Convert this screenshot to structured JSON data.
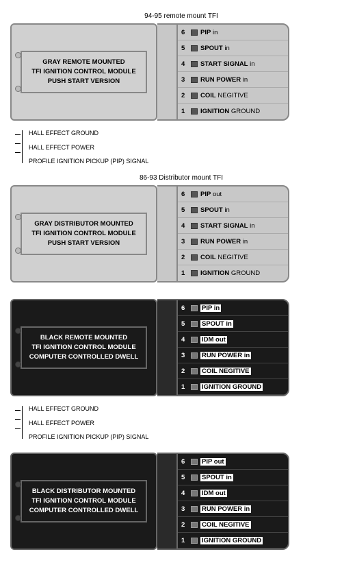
{
  "sections": [
    {
      "id": "gray-remote",
      "topLabel": "94-95 remote mount TFI",
      "moduleText": "GRAY REMOTE MOUNTED\nTFI IGNITION CONTROL MODULE\nPUSH START VERSION",
      "isBlack": false,
      "pins": [
        {
          "num": 6,
          "label": "PIP in",
          "bold": [
            "PIP"
          ]
        },
        {
          "num": 5,
          "label": "SPOUT in",
          "bold": [
            "SPOUT"
          ]
        },
        {
          "num": 4,
          "label": "START SIGNAL in",
          "bold": [
            "START SIGNAL"
          ]
        },
        {
          "num": 3,
          "label": "RUN POWER in",
          "bold": [
            "RUN POWER"
          ]
        },
        {
          "num": 2,
          "label": "COIL NEGITIVE",
          "bold": [
            "COIL"
          ]
        },
        {
          "num": 1,
          "label": "IGNITION GROUND",
          "bold": [
            "IGNITION"
          ]
        }
      ],
      "wires": null
    },
    {
      "id": "gray-dist",
      "topLabel": "86-93 Distributor mount TFI",
      "moduleText": "GRAY DISTRIBUTOR MOUNTED\nTFI IGNITION CONTROL MODULE\nPUSH START VERSION",
      "isBlack": false,
      "pins": [
        {
          "num": 6,
          "label": "PIP out",
          "bold": [
            "PIP"
          ]
        },
        {
          "num": 5,
          "label": "SPOUT in",
          "bold": [
            "SPOUT"
          ]
        },
        {
          "num": 4,
          "label": "START SIGNAL in",
          "bold": [
            "START SIGNAL"
          ]
        },
        {
          "num": 3,
          "label": "RUN POWER in",
          "bold": [
            "RUN POWER"
          ]
        },
        {
          "num": 2,
          "label": "COIL NEGITIVE",
          "bold": [
            "COIL"
          ]
        },
        {
          "num": 1,
          "label": "IGNITION GROUND",
          "bold": [
            "IGNITION"
          ]
        }
      ],
      "wires": {
        "items": [
          "HALL EFFECT GROUND",
          "HALL EFFECT POWER",
          "PROFILE IGNITION PICKUP (PIP) SIGNAL"
        ]
      }
    },
    {
      "id": "black-remote",
      "topLabel": null,
      "moduleText": "BLACK REMOTE MOUNTED\nTFI IGNITION CONTROL MODULE\nCOMPUTER CONTROLLED DWELL",
      "isBlack": true,
      "pins": [
        {
          "num": 6,
          "label": "PIP in",
          "bold": [
            "PIP"
          ]
        },
        {
          "num": 5,
          "label": "SPOUT in",
          "bold": [
            "SPOUT"
          ]
        },
        {
          "num": 4,
          "label": "IDM out",
          "bold": [
            "IDM"
          ]
        },
        {
          "num": 3,
          "label": "RUN POWER in",
          "bold": [
            "RUN POWER"
          ]
        },
        {
          "num": 2,
          "label": "COIL NEGITIVE",
          "bold": [
            "COIL"
          ]
        },
        {
          "num": 1,
          "label": "IGNITION GROUND",
          "bold": [
            "IGNITION"
          ]
        }
      ],
      "wires": null
    },
    {
      "id": "black-dist",
      "topLabel": null,
      "moduleText": "BLACK DISTRIBUTOR MOUNTED\nTFI IGNITION CONTROL MODULE\nCOMPUTER CONTROLLED DWELL",
      "isBlack": true,
      "pins": [
        {
          "num": 6,
          "label": "PIP out",
          "bold": [
            "PIP"
          ]
        },
        {
          "num": 5,
          "label": "SPOUT in",
          "bold": [
            "SPOUT"
          ]
        },
        {
          "num": 4,
          "label": "IDM out",
          "bold": [
            "IDM"
          ]
        },
        {
          "num": 3,
          "label": "RUN POWER in",
          "bold": [
            "RUN POWER"
          ]
        },
        {
          "num": 2,
          "label": "COIL NEGITIVE",
          "bold": [
            "COIL"
          ]
        },
        {
          "num": 1,
          "label": "IGNITION GROUND",
          "bold": [
            "IGNITION"
          ]
        }
      ],
      "wires": {
        "items": [
          "HALL EFFECT GROUND",
          "HALL EFFECT POWER",
          "PROFILE IGNITION PICKUP (PIP) SIGNAL"
        ]
      }
    }
  ],
  "wireAnnotations": {
    "hallGround": "HALL EFFECT GROUND",
    "hallPower": "HALL EFFECT POWER",
    "pipSignal": "PROFILE IGNITION PICKUP (PIP) SIGNAL"
  }
}
